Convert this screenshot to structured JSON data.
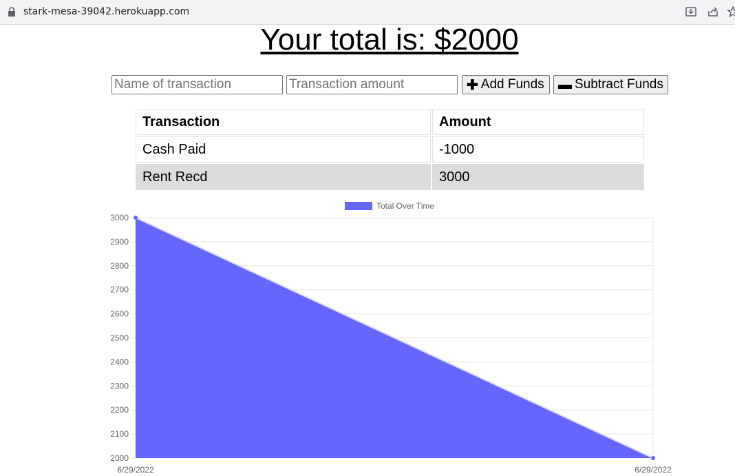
{
  "browser": {
    "url": "stark-mesa-39042.herokuapp.com"
  },
  "page": {
    "total_prefix": "Your total is: $",
    "total_value": "2000"
  },
  "form": {
    "name_placeholder": "Name of transaction",
    "amount_placeholder": "Transaction amount",
    "add_label": "Add Funds",
    "subtract_label": "Subtract Funds"
  },
  "table": {
    "headers": [
      "Transaction",
      "Amount"
    ],
    "rows": [
      [
        "Cash Paid",
        "-1000"
      ],
      [
        "Rent Recd",
        "3000"
      ]
    ]
  },
  "chart_data": {
    "type": "area",
    "legend": [
      "Total Over Time"
    ],
    "legend_position": "top",
    "categories": [
      "6/29/2022",
      "6/29/2022"
    ],
    "series": [
      {
        "name": "Total Over Time",
        "values": [
          3000,
          2000
        ],
        "color": "#6666ff"
      }
    ],
    "yticks": [
      2000,
      2100,
      2200,
      2300,
      2400,
      2500,
      2600,
      2700,
      2800,
      2900,
      3000
    ],
    "ylim": [
      2000,
      3000
    ],
    "grid": true
  }
}
